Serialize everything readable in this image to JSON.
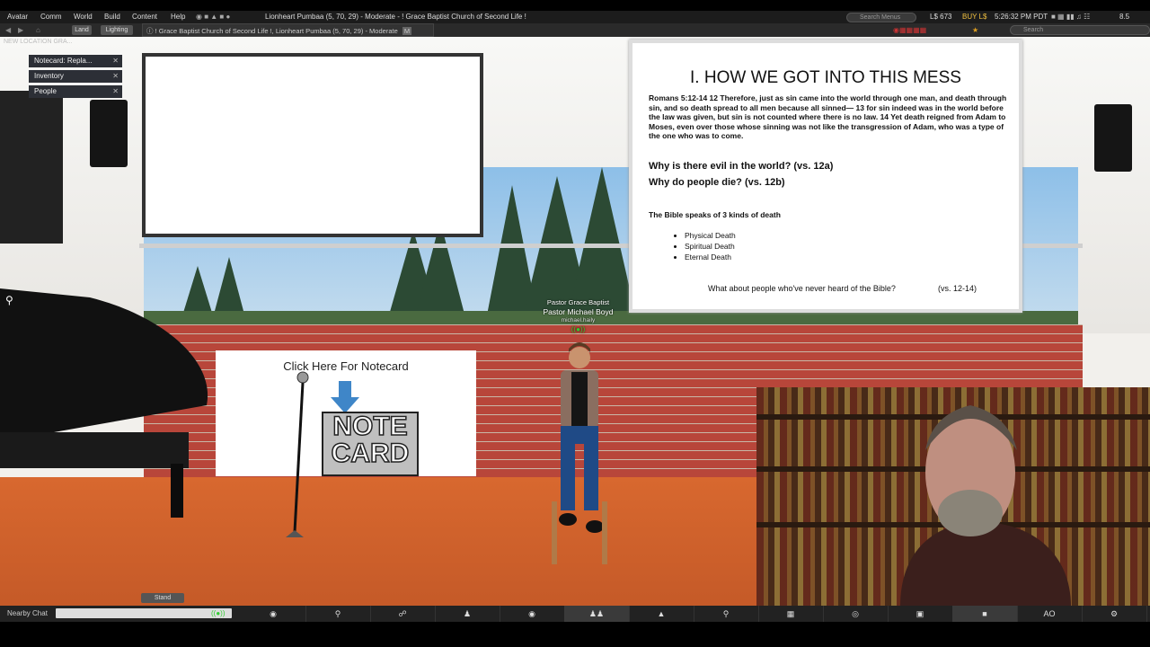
{
  "menubar": {
    "items": [
      "Avatar",
      "Comm",
      "World",
      "Build",
      "Content",
      "Help"
    ],
    "location": "Lionheart Pumbaa (5, 70, 29) - Moderate - ! Grace Baptist Church of Second Life !",
    "search_placeholder": "Search Menus",
    "balance": "L$ 673",
    "buy_label": "BUY L$",
    "time": "5:26:32 PM PDT",
    "fps": "8.5"
  },
  "navbar": {
    "land_label": "Land",
    "lighting_label": "Lighting",
    "address": "! Grace Baptist Church of Second Life !, Lionheart Pumbaa (5, 70, 29) - Moderate",
    "maturity_badge": "M",
    "search_placeholder": "Search"
  },
  "location_history": "NEW LOCATION GRA...",
  "panels": [
    {
      "label": "Notecard: Repla..."
    },
    {
      "label": "Inventory"
    },
    {
      "label": "People"
    }
  ],
  "slide": {
    "heading": "I.  HOW WE GOT INTO THIS MESS",
    "romans": "Romans 5:12-14  12 Therefore, just as sin came into the world through one man, and death through sin, and so death spread to all men because all sinned— 13 for sin indeed was in the world before the law was given, but sin is not counted where there is no law. 14 Yet death reigned from Adam to Moses, even over those whose sinning was not like the transgression of Adam, who was a type of the one who was to come.",
    "question1": "Why is there evil in the world?  (vs. 12a)",
    "question2": "Why do people die?  (vs. 12b)",
    "kinds": "The Bible speaks of 3 kinds of death",
    "deaths": [
      "Physical Death",
      "Spiritual Death",
      "Eternal Death"
    ],
    "what_about": "What about people who've never heard of the Bible?",
    "verses": "(vs. 12-14)"
  },
  "avatar": {
    "group_title": "Pastor Grace Baptist",
    "name": "Pastor Michael Boyd",
    "username": "michael.haily"
  },
  "board": {
    "title": "Click Here For Notecard",
    "note_line1": "NOTE",
    "note_line2": "CARD"
  },
  "stand_label": "Stand",
  "chat": {
    "label": "Nearby Chat"
  },
  "toolbar": {
    "ao_label": "AO"
  },
  "colors": {
    "brick": "#b8463a",
    "floor": "#d8682f",
    "sky": "#7fb7e6",
    "arrow": "#3f86c8"
  }
}
